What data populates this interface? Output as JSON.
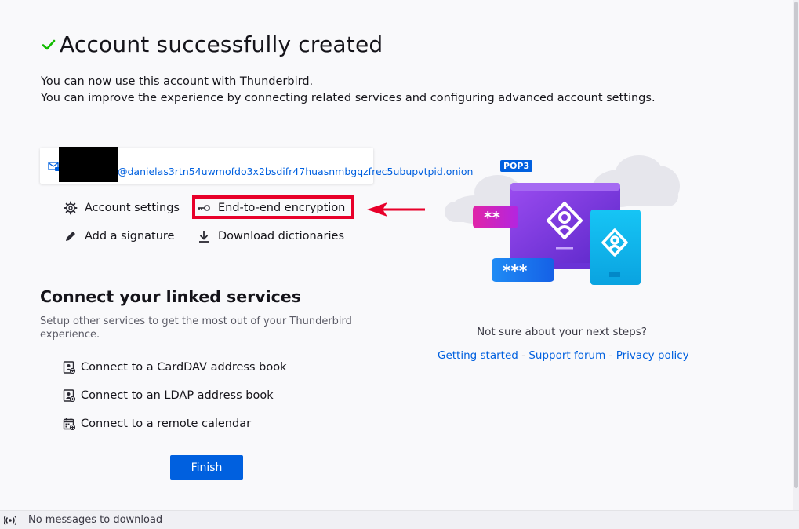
{
  "header": {
    "title": "Account successfully created",
    "line1": "You can now use this account with Thunderbird.",
    "line2": "You can improve the experience by connecting related services and configuring advanced account settings."
  },
  "account": {
    "email": "@danielas3rtn54uwmofdo3x2bsdifr47huasnmbgqzfrec5ubupvtpid.onion",
    "protocol_badge": "POP3"
  },
  "actions": {
    "account_settings": "Account settings",
    "e2e_encryption": "End-to-end encryption",
    "add_signature": "Add a signature",
    "download_dictionaries": "Download dictionaries"
  },
  "linked_services": {
    "title": "Connect your linked services",
    "subtitle": "Setup other services to get the most out of your Thunderbird experience.",
    "items": [
      "Connect to a CardDAV address book",
      "Connect to an LDAP address book",
      "Connect to a remote calendar"
    ]
  },
  "finish_label": "Finish",
  "help": {
    "question": "Not sure about your next steps?",
    "getting_started": "Getting started",
    "support_forum": "Support forum",
    "privacy_policy": "Privacy policy",
    "separator": " - "
  },
  "illustration": {
    "password_mask_top": "**",
    "password_mask_bottom": "***"
  },
  "status_bar": {
    "text": "No messages to download"
  },
  "colors": {
    "accent": "#0060df",
    "success": "#12bc00",
    "annotation": "#e8002a"
  }
}
